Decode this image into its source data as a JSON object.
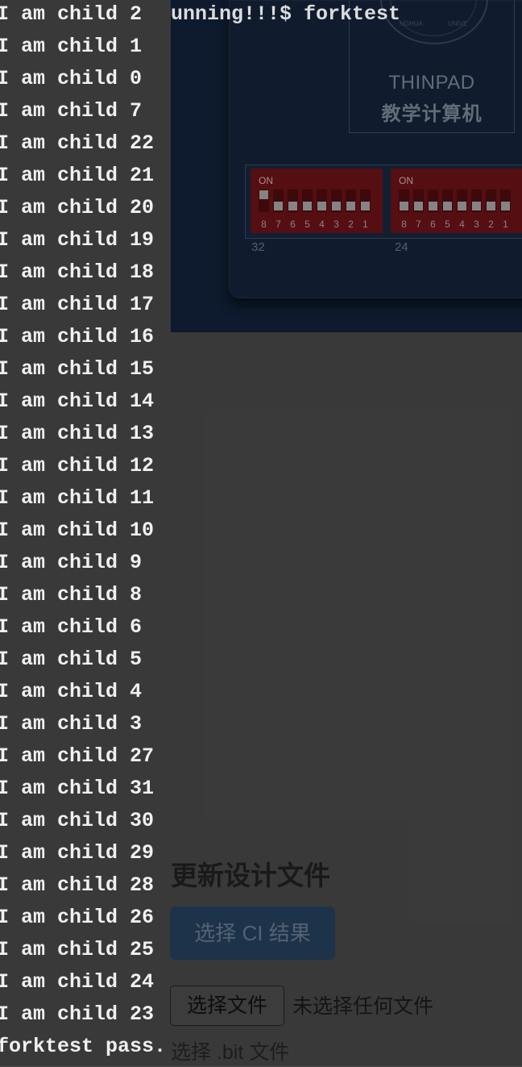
{
  "board": {
    "brand": "THINPAD",
    "subtitle": "教学计算机",
    "seal_text_left": "NGHUA",
    "seal_text_right": "UNIVE",
    "dip_banks": [
      {
        "on_label": "ON",
        "numbers": [
          "8",
          "7",
          "6",
          "5",
          "4",
          "3",
          "2",
          "1"
        ],
        "bank_label": "32",
        "knobs_up": [
          true,
          false,
          false,
          false,
          false,
          false,
          false,
          false
        ]
      },
      {
        "on_label": "ON",
        "numbers": [
          "8",
          "7",
          "6",
          "5",
          "4",
          "3",
          "2",
          "1"
        ],
        "bank_label": "24",
        "knobs_up": [
          false,
          false,
          false,
          false,
          false,
          false,
          false,
          false
        ]
      }
    ],
    "colors": {
      "board_bg": "#12223a",
      "dip_red": "#6d1218"
    }
  },
  "terminal": {
    "prompt_overlay": "unning!!!$ forktest",
    "lines": [
      "I am child 2",
      "I am child 1",
      "I am child 0",
      "I am child 7",
      "I am child 22",
      "I am child 21",
      "I am child 20",
      "I am child 19",
      "I am child 18",
      "I am child 17",
      "I am child 16",
      "I am child 15",
      "I am child 14",
      "I am child 13",
      "I am child 12",
      "I am child 11",
      "I am child 10",
      "I am child 9",
      "I am child 8",
      "I am child 6",
      "I am child 5",
      "I am child 4",
      "I am child 3",
      "I am child 27",
      "I am child 31",
      "I am child 30",
      "I am child 29",
      "I am child 28",
      "I am child 26",
      "I am child 25",
      "I am child 24",
      "I am child 23",
      "forktest pass."
    ]
  },
  "upload": {
    "section_title": "更新设计文件",
    "ci_button_label": "选择 CI 结果",
    "file_button_label": "选择文件",
    "file_status": "未选择任何文件",
    "bit_label": "选择 .bit 文件"
  }
}
